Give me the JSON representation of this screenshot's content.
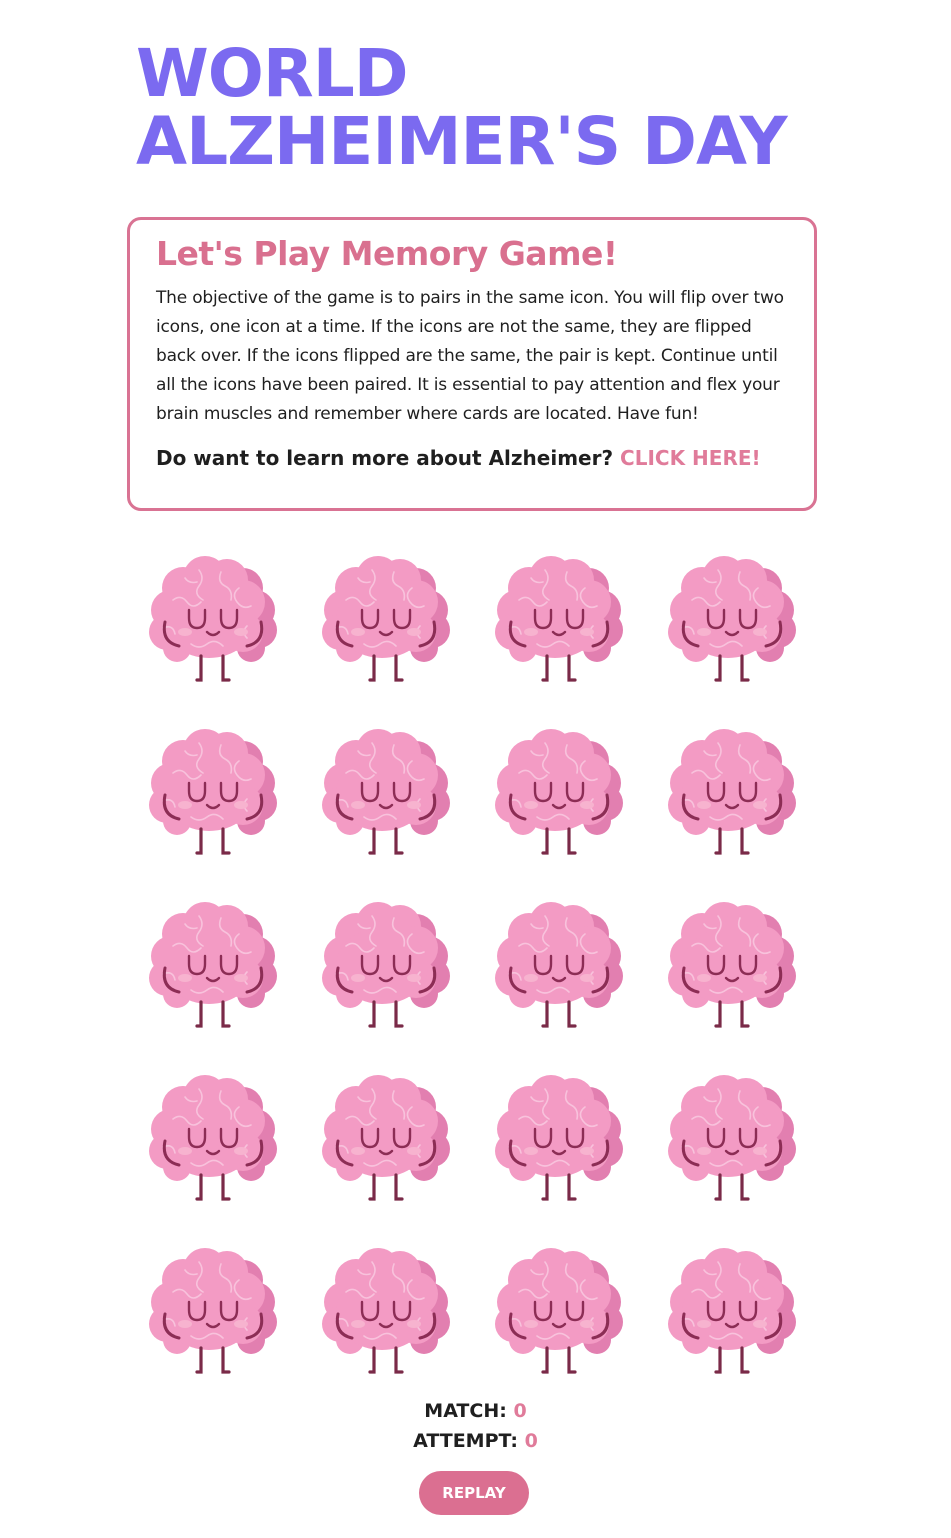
{
  "header": {
    "title_line1": "WORLD",
    "title_line2": "ALZHEIMER'S DAY"
  },
  "info": {
    "heading": "Let's Play Memory Game!",
    "description": "The objective of the game is to pairs in the same icon. You will flip over two icons, one icon at a time. If the icons are not the same, they are flipped back over. If the icons flipped are the same, the pair is kept. Continue until all the icons have been paired. It is essential to pay attention and flex your brain muscles and remember where cards are located. Have fun!",
    "learn_prompt": "Do want to learn more about Alzheimer?",
    "learn_link": "CLICK HERE!"
  },
  "board": {
    "rows": 5,
    "columns": 4,
    "card_back_icon": "brain-icon",
    "colors": {
      "brain_main": "#f39bc4",
      "brain_shade": "#e27fb0",
      "brain_line": "#f8c2dc",
      "face": "#8c2d55",
      "cheek": "#f7b3cf",
      "legs": "#7a2a48"
    }
  },
  "stats": {
    "match_label": "MATCH:",
    "match_value": "0",
    "attempt_label": "ATTEMPT:",
    "attempt_value": "0"
  },
  "controls": {
    "replay_label": "REPLAY"
  },
  "theme": {
    "title_color": "#7b6af0",
    "accent": "#d9708f",
    "button_bg": "#db6f91"
  }
}
